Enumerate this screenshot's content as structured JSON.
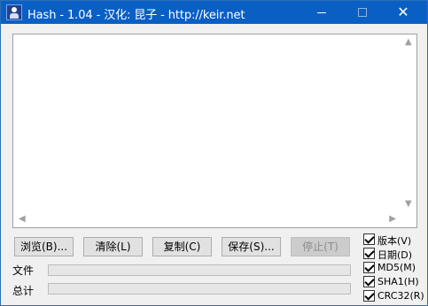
{
  "window": {
    "title": "Hash - 1.04 - 汉化: 昆子 - http://keir.net",
    "minimize_glyph": "—",
    "maximize_glyph": "☐",
    "close_glyph": "✕"
  },
  "output": {
    "text": "",
    "scroll_up": "▲",
    "scroll_down": "▼",
    "scroll_left": "◀",
    "scroll_right": "▶"
  },
  "buttons": {
    "browse": "浏览(B)...",
    "clear": "清除(L)",
    "copy": "复制(C)",
    "save": "保存(S)...",
    "stop": "停止(T)"
  },
  "progress": {
    "file_label": "文件",
    "total_label": "总计",
    "file_value": 0,
    "total_value": 0
  },
  "options": [
    {
      "label": "版本(V)",
      "checked": true
    },
    {
      "label": "日期(D)",
      "checked": true
    },
    {
      "label": "MD5(M)",
      "checked": true
    },
    {
      "label": "SHA1(H)",
      "checked": true
    },
    {
      "label": "CRC32(R)",
      "checked": true
    }
  ],
  "colors": {
    "titlebar": "#0a5fc4",
    "accent_border": "#2b6fb6",
    "window_bg": "#f0f0f0",
    "progress_fill": "#06b025"
  },
  "icons": {
    "app": "hash-app-icon",
    "minimize": "minimize-icon",
    "maximize": "maximize-icon",
    "close": "close-icon"
  }
}
